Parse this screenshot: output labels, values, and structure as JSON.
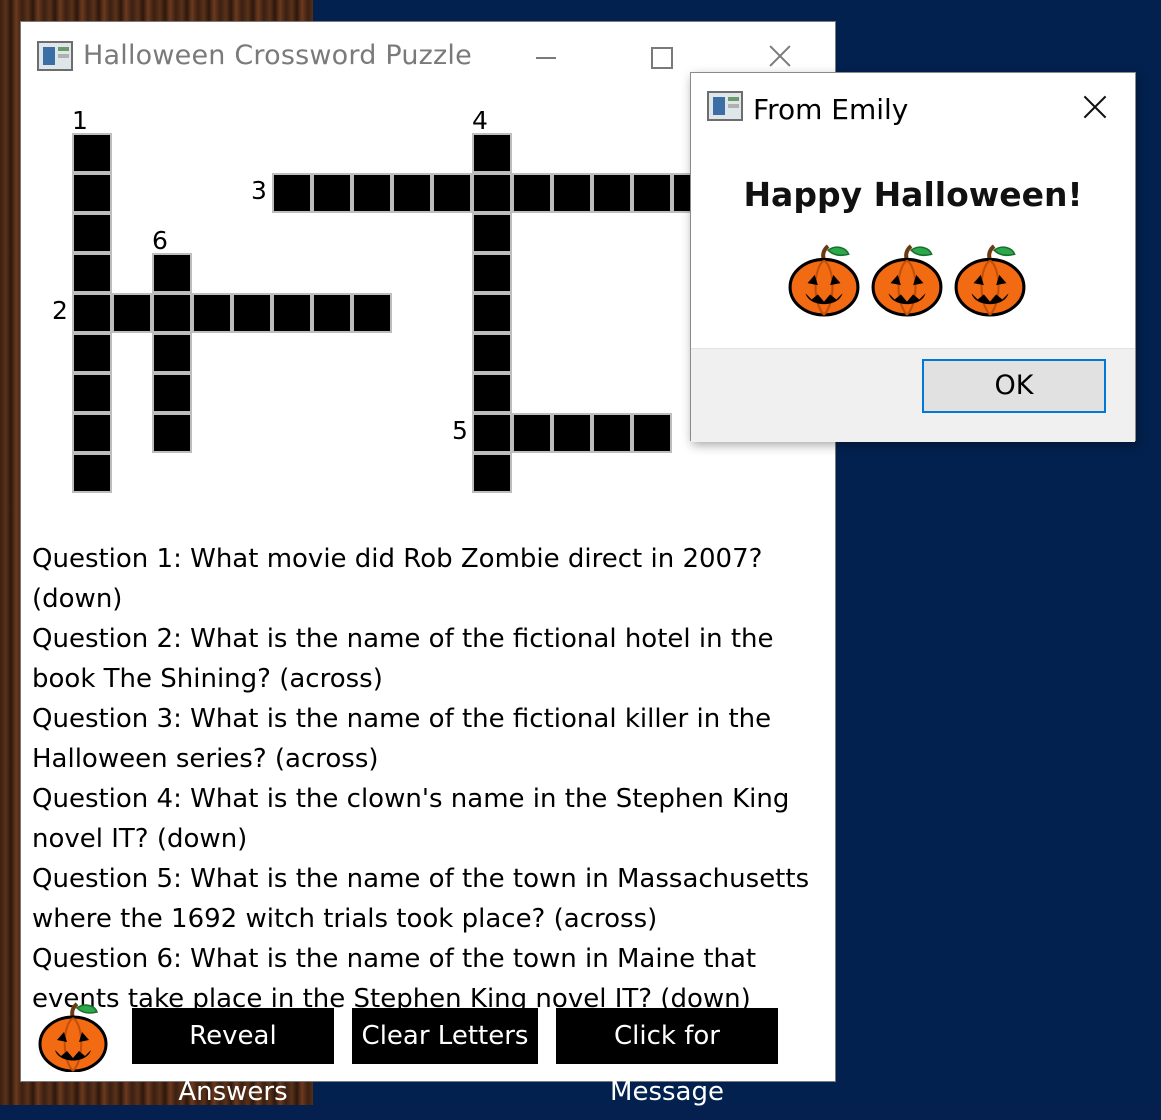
{
  "main_window": {
    "title": "Halloween Crossword Puzzle"
  },
  "crossword": {
    "clue_numbers": [
      "1",
      "2",
      "3",
      "4",
      "5",
      "6"
    ]
  },
  "questions": [
    "Question 1: What movie did Rob Zombie direct in 2007? (down)",
    "Question 2: What is the name of the fictional hotel in the book The Shining? (across)",
    "Question 3: What is the name of the fictional killer in the Halloween series? (across)",
    "Question 4: What is the clown's name in the Stephen King novel IT? (down)",
    "Question 5: What is the name of the town in Massachusetts where the 1692 witch trials took place? (across)",
    "Question 6: What is the name of the town in Maine that events take place in the Stephen King novel IT? (down)"
  ],
  "buttons": {
    "reveal": "Reveal Answers",
    "clear": "Clear Letters",
    "message": "Click for Message"
  },
  "dialog": {
    "title": "From Emily",
    "heading": "Happy Halloween!",
    "ok": "OK"
  },
  "icons": {
    "pumpkin": "pumpkin-icon",
    "app": "app-icon"
  },
  "colors": {
    "desktop": "#03214f",
    "pumpkin": "#f26a12",
    "ok_border": "#0078d7"
  }
}
